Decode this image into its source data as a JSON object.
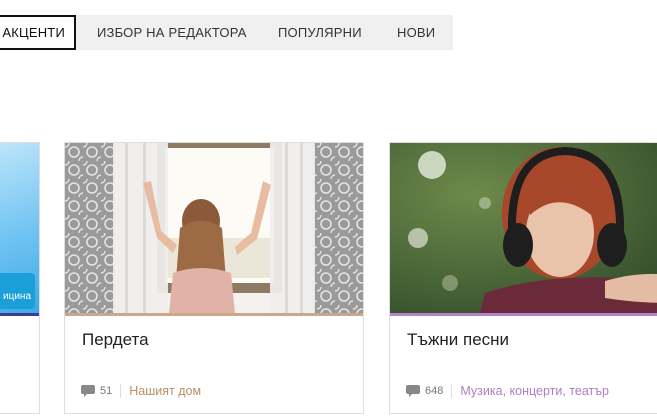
{
  "tabs": [
    {
      "label": "АКЦЕНТИ",
      "active": true
    },
    {
      "label": "ИЗБОР НА РЕДАКТОРА",
      "active": false
    },
    {
      "label": "ПОПУЛЯРНИ",
      "active": false
    },
    {
      "label": "НОВИ",
      "active": false
    }
  ],
  "cards": [
    {
      "title": "",
      "badge": "ицина",
      "accent_color": "#3a3d97"
    },
    {
      "title": "Пердета",
      "comments": "51",
      "category": "Нашият дом",
      "accent_color": "#c9a98a",
      "category_color": "#b9906a"
    },
    {
      "title": "Тъжни песни",
      "comments": "648",
      "category": "Музика, концерти, театър",
      "accent_color": "#b584c6",
      "category_color": "#b07cc4"
    }
  ]
}
